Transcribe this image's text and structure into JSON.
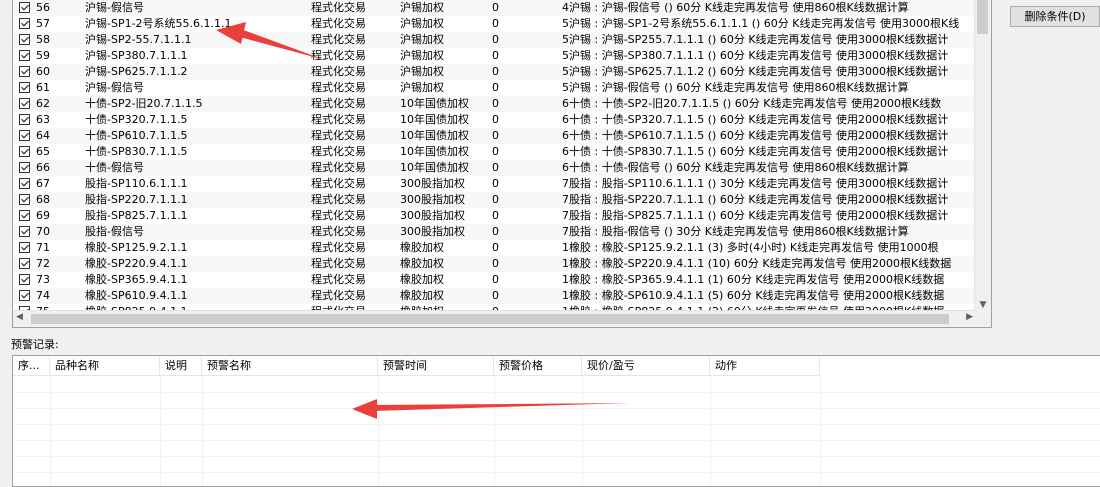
{
  "rules": {
    "rows": [
      {
        "id": "56",
        "name": "沪锡-假信号",
        "type": "程式化交易",
        "index": "沪锡加权",
        "num": "0",
        "desc": "4沪锡 : 沪锡-假信号 () 60分 K线走完再发信号 使用860根K线数据计算"
      },
      {
        "id": "57",
        "name": "沪锡-SP1-2号系统55.6.1.1.1",
        "type": "程式化交易",
        "index": "沪锡加权",
        "num": "0",
        "desc": "5沪锡 : 沪锡-SP1-2号系统55.6.1.1.1 () 60分 K线走完再发信号 使用3000根K线"
      },
      {
        "id": "58",
        "name": "沪锡-SP2-55.7.1.1.1",
        "type": "程式化交易",
        "index": "沪锡加权",
        "num": "0",
        "desc": "5沪锡 : 沪锡-SP255.7.1.1.1 () 60分 K线走完再发信号 使用3000根K线数据计"
      },
      {
        "id": "59",
        "name": "沪锡-SP380.7.1.1.1",
        "type": "程式化交易",
        "index": "沪锡加权",
        "num": "0",
        "desc": "5沪锡 : 沪锡-SP380.7.1.1.1 () 60分 K线走完再发信号 使用3000根K线数据计"
      },
      {
        "id": "60",
        "name": "沪锡-SP625.7.1.1.2",
        "type": "程式化交易",
        "index": "沪锡加权",
        "num": "0",
        "desc": "5沪锡 : 沪锡-SP625.7.1.1.2 () 60分 K线走完再发信号 使用3000根K线数据计"
      },
      {
        "id": "61",
        "name": "沪锡-假信号",
        "type": "程式化交易",
        "index": "沪锡加权",
        "num": "0",
        "desc": "5沪锡 : 沪锡-假信号 () 60分 K线走完再发信号 使用860根K线数据计算"
      },
      {
        "id": "62",
        "name": "十债-SP2-旧20.7.1.1.5",
        "type": "程式化交易",
        "index": "10年国债加权",
        "num": "0",
        "desc": "6十债 : 十债-SP2-旧20.7.1.1.5 () 60分 K线走完再发信号 使用2000根K线数"
      },
      {
        "id": "63",
        "name": "十债-SP320.7.1.1.5",
        "type": "程式化交易",
        "index": "10年国债加权",
        "num": "0",
        "desc": "6十债 : 十债-SP320.7.1.1.5 () 60分 K线走完再发信号 使用2000根K线数据计"
      },
      {
        "id": "64",
        "name": "十债-SP610.7.1.1.5",
        "type": "程式化交易",
        "index": "10年国债加权",
        "num": "0",
        "desc": "6十债 : 十债-SP610.7.1.1.5 () 60分 K线走完再发信号 使用2000根K线数据计"
      },
      {
        "id": "65",
        "name": "十债-SP830.7.1.1.5",
        "type": "程式化交易",
        "index": "10年国债加权",
        "num": "0",
        "desc": "6十债 : 十债-SP830.7.1.1.5 () 60分 K线走完再发信号 使用2000根K线数据计"
      },
      {
        "id": "66",
        "name": "十债-假信号",
        "type": "程式化交易",
        "index": "10年国债加权",
        "num": "0",
        "desc": "6十债 : 十债-假信号 () 60分 K线走完再发信号 使用860根K线数据计算"
      },
      {
        "id": "67",
        "name": "股指-SP110.6.1.1.1",
        "type": "程式化交易",
        "index": "300股指加权",
        "num": "0",
        "desc": "7股指 : 股指-SP110.6.1.1.1 () 30分 K线走完再发信号 使用3000根K线数据计"
      },
      {
        "id": "68",
        "name": "股指-SP220.7.1.1.1",
        "type": "程式化交易",
        "index": "300股指加权",
        "num": "0",
        "desc": "7股指 : 股指-SP220.7.1.1.1 () 60分 K线走完再发信号 使用2000根K线数据计"
      },
      {
        "id": "69",
        "name": "股指-SP825.7.1.1.1",
        "type": "程式化交易",
        "index": "300股指加权",
        "num": "0",
        "desc": "7股指 : 股指-SP825.7.1.1.1 () 60分 K线走完再发信号 使用2000根K线数据计"
      },
      {
        "id": "70",
        "name": "股指-假信号",
        "type": "程式化交易",
        "index": "300股指加权",
        "num": "0",
        "desc": "7股指 : 股指-假信号 () 30分 K线走完再发信号 使用860根K线数据计算"
      },
      {
        "id": "71",
        "name": "橡胶-SP125.9.2.1.1",
        "type": "程式化交易",
        "index": "橡胶加权",
        "num": "0",
        "desc": "1橡胶 : 橡胶-SP125.9.2.1.1 (3) 多时(4小时) K线走完再发信号 使用1000根"
      },
      {
        "id": "72",
        "name": "橡胶-SP220.9.4.1.1",
        "type": "程式化交易",
        "index": "橡胶加权",
        "num": "0",
        "desc": "1橡胶 : 橡胶-SP220.9.4.1.1 (10) 60分 K线走完再发信号 使用2000根K线数据"
      },
      {
        "id": "73",
        "name": "橡胶-SP365.9.4.1.1",
        "type": "程式化交易",
        "index": "橡胶加权",
        "num": "0",
        "desc": "1橡胶 : 橡胶-SP365.9.4.1.1 (1) 60分 K线走完再发信号 使用2000根K线数据"
      },
      {
        "id": "74",
        "name": "橡胶-SP610.9.4.1.1",
        "type": "程式化交易",
        "index": "橡胶加权",
        "num": "0",
        "desc": "1橡胶 : 橡胶-SP610.9.4.1.1 (5) 60分 K线走完再发信号 使用2000根K线数据"
      },
      {
        "id": "75",
        "name": "橡胶-SP825.9.4.1.1",
        "type": "程式化交易",
        "index": "橡胶加权",
        "num": "0",
        "desc": "1橡胶 : 橡胶-SP825.9.4.1.1 (2) 60分 K线走完再发信号 使用2000根K线数据"
      }
    ]
  },
  "delete_button": "删除条件(D)",
  "alert_log": {
    "label": "预警记录:",
    "columns": [
      "序...",
      "品种名称",
      "说明",
      "预警名称",
      "预警时间",
      "预警价格",
      "现价/盈亏",
      "动作"
    ]
  },
  "colors": {
    "annotation_arrow": "#e8413c",
    "grid_border": "#a0a0a0"
  }
}
